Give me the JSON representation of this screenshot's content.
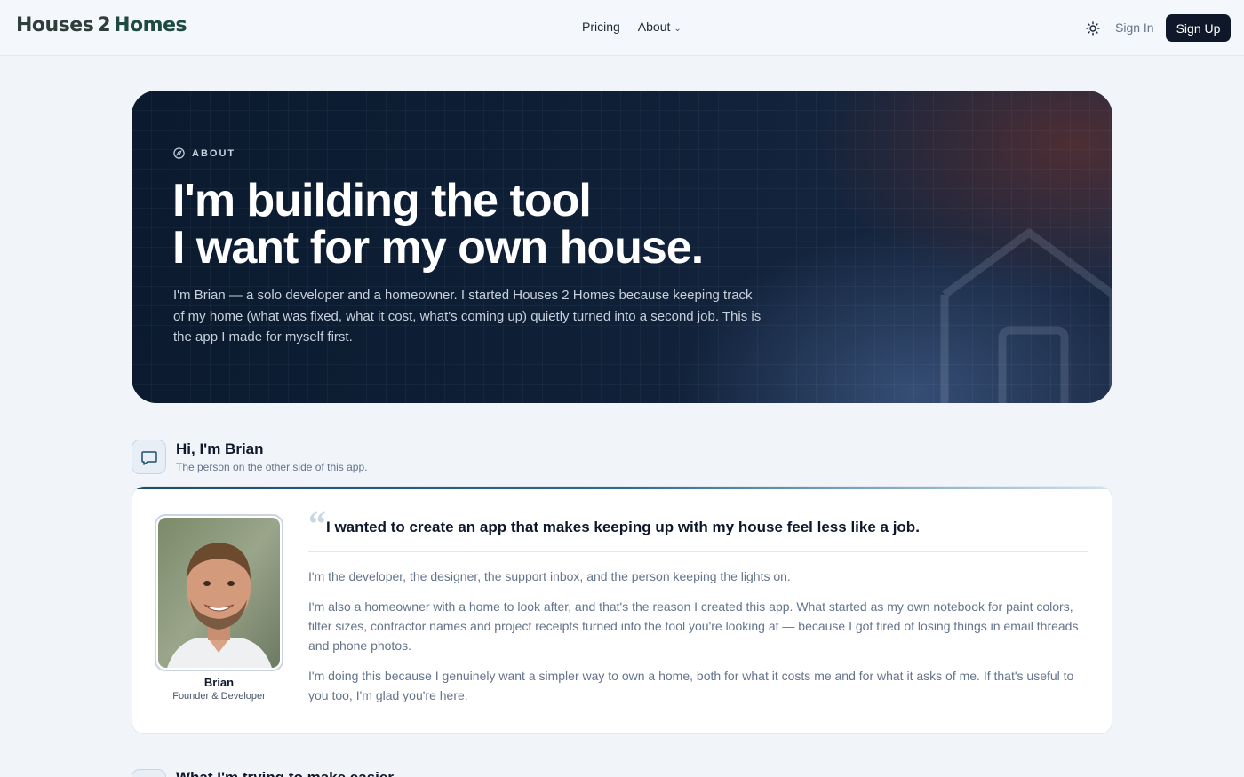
{
  "header": {
    "logo_left": "Houses",
    "logo_num": "2",
    "logo_right": "Homes",
    "nav": {
      "pricing": "Pricing",
      "about": "About"
    },
    "signin": "Sign In",
    "signup": "Sign Up"
  },
  "hero": {
    "eyebrow": "ABOUT",
    "title_line1": "I'm building the tool",
    "title_line2": "I want for my own house.",
    "text": "I'm Brian — a solo developer and a homeowner. I started Houses 2 Homes because keeping track of my home (what was fixed, what it cost, what's coming up) quietly turned into a second job. This is the app I made for myself first."
  },
  "intro_section": {
    "title": "Hi, I'm Brian",
    "subtitle": "The person on the other side of this app."
  },
  "profile": {
    "name": "Brian",
    "role": "Founder & Developer",
    "quote": "I wanted to create an app that makes keeping up with my house feel less like a job.",
    "paragraphs": [
      "I'm the developer, the designer, the support inbox, and the person keeping the lights on.",
      "I'm also a homeowner with a home to look after, and that's the reason I created this app. What started as my own notebook for paint colors, filter sizes, contractor names and project receipts turned into the tool you're looking at — because I got tired of losing things in email threads and phone photos.",
      "I'm doing this because I genuinely want a simpler way to own a home, both for what it costs me and for what it asks of me. If that's useful to you too, I'm glad you're here."
    ]
  },
  "next_section": {
    "title": "What I'm trying to make easier"
  },
  "colors": {
    "primary": "#0f172a",
    "accent": "#1e4d6b",
    "hero_bg": "#0e1f36"
  }
}
